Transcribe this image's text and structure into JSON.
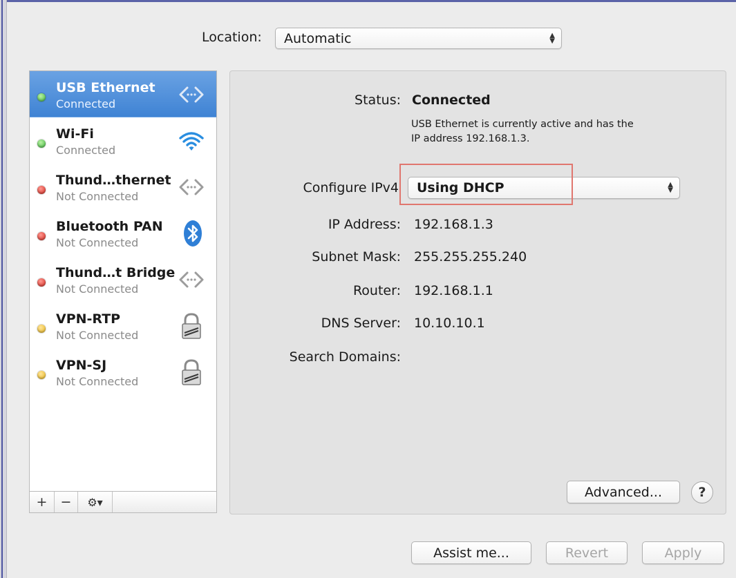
{
  "location": {
    "label": "Location:",
    "value": "Automatic"
  },
  "services": [
    {
      "name": "USB Ethernet",
      "status": "Connected",
      "status_color": "green",
      "icon": "ethernet-arrows-icon",
      "selected": true
    },
    {
      "name": "Wi-Fi",
      "status": "Connected",
      "status_color": "green",
      "icon": "wifi-icon",
      "selected": false
    },
    {
      "name": "Thund…thernet",
      "status": "Not Connected",
      "status_color": "red",
      "icon": "ethernet-arrows-icon",
      "selected": false
    },
    {
      "name": "Bluetooth PAN",
      "status": "Not Connected",
      "status_color": "red",
      "icon": "bluetooth-icon",
      "selected": false
    },
    {
      "name": "Thund…t Bridge",
      "status": "Not Connected",
      "status_color": "red",
      "icon": "ethernet-arrows-icon",
      "selected": false
    },
    {
      "name": "VPN-RTP",
      "status": "Not Connected",
      "status_color": "yellow",
      "icon": "vpn-lock-icon",
      "selected": false
    },
    {
      "name": "VPN-SJ",
      "status": "Not Connected",
      "status_color": "yellow",
      "icon": "vpn-lock-icon",
      "selected": false
    }
  ],
  "toolbar": {
    "add": "+",
    "remove": "−",
    "gear": "⚙▾"
  },
  "details": {
    "status_label": "Status:",
    "status_value": "Connected",
    "status_desc_line1": "USB Ethernet is currently active and has the",
    "status_desc_line2": "IP address 192.168.1.3.",
    "configure_label": "Configure IPv4",
    "configure_value": "Using DHCP",
    "ip_label": "IP Address:",
    "ip_value": "192.168.1.3",
    "subnet_label": "Subnet Mask:",
    "subnet_value": "255.255.255.240",
    "router_label": "Router:",
    "router_value": "192.168.1.1",
    "dns_label": "DNS Server:",
    "dns_value": "10.10.10.1",
    "search_label": "Search Domains:",
    "advanced_label": "Advanced...",
    "help_label": "?"
  },
  "footer": {
    "assist_label": "Assist me...",
    "revert_label": "Revert",
    "apply_label": "Apply"
  },
  "colors": {
    "selection": "#3f83d4",
    "highlight_box": "#e0766e",
    "connected": "#3cb33c",
    "not_connected": "#d2241b",
    "vpn": "#e7b31a"
  }
}
